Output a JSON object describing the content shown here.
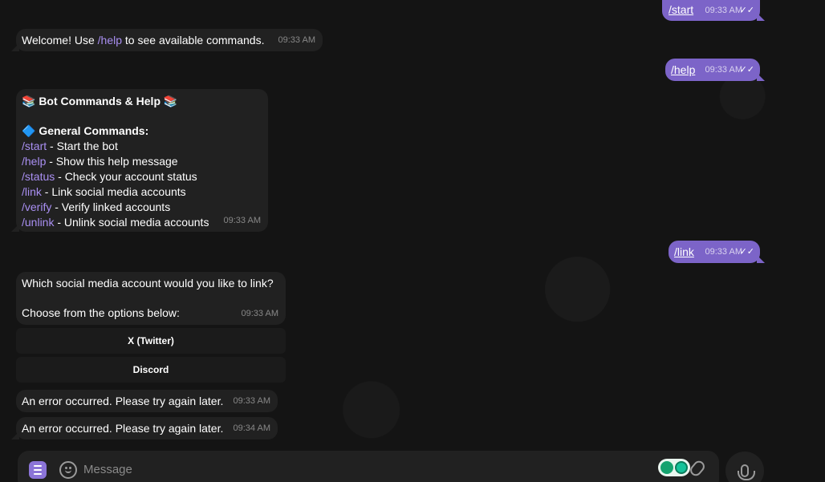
{
  "chat": {
    "outgoing": [
      {
        "text": "/start",
        "time": "09:33 AM",
        "status_icon": "double-check-icon"
      },
      {
        "text": "/help",
        "time": "09:33 AM",
        "status_icon": "double-check-icon"
      },
      {
        "text": "/link",
        "time": "09:33 AM",
        "status_icon": "double-check-icon"
      }
    ],
    "welcome": {
      "prefix": "Welcome! Use ",
      "command": "/help",
      "suffix": " to see available commands.",
      "time": "09:33 AM"
    },
    "help": {
      "title": "📚 Bot Commands & Help 📚",
      "section": "🔷 General Commands:",
      "commands": [
        {
          "cmd": "/start",
          "desc": " - Start the bot"
        },
        {
          "cmd": "/help",
          "desc": " - Show this help message"
        },
        {
          "cmd": "/status",
          "desc": " - Check your account status"
        },
        {
          "cmd": "/link",
          "desc": " - Link social media accounts"
        },
        {
          "cmd": "/verify",
          "desc": " - Verify linked accounts"
        },
        {
          "cmd": "/unlink",
          "desc": " - Unlink social media accounts"
        }
      ],
      "time": "09:33 AM"
    },
    "link_prompt": {
      "line1": "Which social media account would you like to link?",
      "line2": "Choose from the options below:",
      "time": "09:33 AM"
    },
    "keyboard": [
      {
        "label": "X (Twitter)"
      },
      {
        "label": "Discord"
      }
    ],
    "errors": [
      {
        "text": "An error occurred. Please try again later.",
        "time": "09:33 AM"
      },
      {
        "text": "An error occurred. Please try again later.",
        "time": "09:34 AM"
      }
    ]
  },
  "composer": {
    "placeholder": "Message",
    "menu_icon": "menu-icon",
    "emoji_icon": "smile-icon",
    "attach_icon": "paperclip-icon",
    "mic_icon": "microphone-icon"
  },
  "colors": {
    "outgoing_bubble": "#7c64c8",
    "incoming_bubble": "#212121",
    "command_link": "#a98ff2",
    "background": "#141414"
  }
}
